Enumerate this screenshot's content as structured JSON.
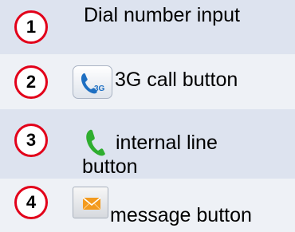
{
  "legend": {
    "items": [
      {
        "number": "1",
        "label": "Dial number input"
      },
      {
        "number": "2",
        "label": "3G call button",
        "icon": "3g-call-icon"
      },
      {
        "number": "3",
        "label_line1": "internal line",
        "label_line2": "button",
        "icon": "green-phone-icon"
      },
      {
        "number": "4",
        "label": "message button",
        "icon": "envelope-icon"
      }
    ]
  },
  "colors": {
    "row_dark": "#dde3ef",
    "row_light": "#eef1f6",
    "badge_border": "#e2001a",
    "phone_blue": "#1e6fc2",
    "phone_green": "#2fae2f",
    "envelope_orange": "#f39a1e"
  },
  "icon_text": {
    "three_g": "3G"
  }
}
